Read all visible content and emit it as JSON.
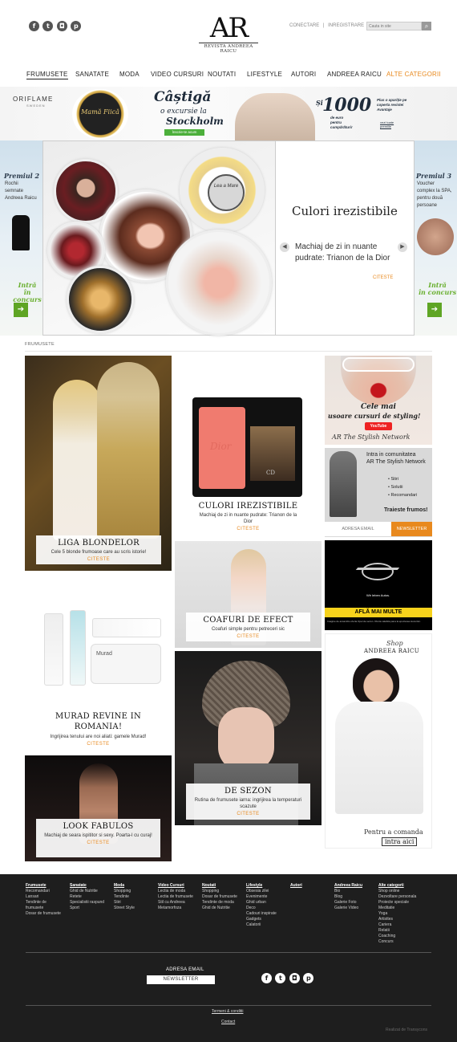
{
  "header": {
    "logo_text": "AR",
    "logo_sub": "REVISTA ANDREEA RAICU",
    "login": "CONECTARE",
    "sep": "|",
    "register": "INREGISTRARE",
    "search_placeholder": "Cauta in site"
  },
  "nav": [
    "FRUMUSETE",
    "SANATATE",
    "MODA",
    "VIDEO CURSURI",
    "NOUTATI",
    "LIFESTYLE",
    "AUTORI",
    "ANDREEA RAICU",
    "ALTE CATEGORII"
  ],
  "banner": {
    "oriflame": "ORIFLAME",
    "brand": "SWEDEN",
    "castiga": "Câștigă",
    "excursie": "o excursie la",
    "oras": "Stockholm",
    "mama": "Mamă Fiică",
    "cta": "Înscrie-te acum",
    "suma": "1000",
    "si": "Și",
    "euro": "de euro pentru cumpărături!",
    "plus": "Plus o apariție pe coperta revistei Avantaje",
    "vezi": "vezi toate premiile"
  },
  "promo_left": {
    "title": "Premiul 2",
    "line1": "Rochii",
    "line2": "semnate",
    "line3": "Andreea Raicu",
    "cta1": "Intră",
    "cta2": "în concurs"
  },
  "promo_right": {
    "title": "Premiul 3",
    "line1": "Voucher",
    "line2": "complex la SPA,",
    "line3": "pentru două",
    "line4": "persoane",
    "cta1": "Intră",
    "cta2": "în concurs"
  },
  "slider": {
    "headline": "Culori irezistibile",
    "subtitle": "Machiaj de zi in nuante pudrate: Trianon de la Dior",
    "read": "CITESTE",
    "jar_label": "Lea a Mare"
  },
  "section_label": "FRUMUSETE",
  "cards": {
    "liga": {
      "title": "LIGA BLONDELOR",
      "sub": "Cele 5 blonde frumoase care au scris istorie!",
      "read": "CITESTE"
    },
    "culori": {
      "title": "CULORI IREZISTIBILE",
      "sub": "Machiaj de zi in nuante pudrate: Trianon de la Dior",
      "read": "CITESTE",
      "brand": "Dior",
      "brand2": "CD"
    },
    "coafuri": {
      "title": "COAFURI DE EFECT",
      "sub": "Coafuri simple pentru petreceri sic",
      "read": "CITESTE"
    },
    "murad": {
      "title": "MURAD REVINE IN ROMANIA!",
      "sub": "Ingrijirea tenului are noi aliati: gamele Murad!",
      "read": "CITESTE",
      "brand": "Murad"
    },
    "sezon": {
      "title": "DE SEZON",
      "sub": "Rutina de frumusete iarna: ingrijirea la temperaturi scazute",
      "read": "CITESTE"
    },
    "look": {
      "title": "LOOK FABULOS",
      "sub": "Machiaj de seara ispititor si sexy. Poarta-l cu curaj!",
      "read": "CITESTE"
    }
  },
  "sidebar": {
    "styling1": "Cele mai",
    "styling2": "usoare cursuri de styling!",
    "youtube": "YouTube",
    "network": "AR The Stylish Network",
    "comm1": "Intra in comunitatea",
    "comm2": "AR The Stylish Network",
    "bullets": [
      "Stiri",
      "Solutii",
      "Recomandari"
    ],
    "slogan": "Traieste frumos!",
    "email_ph": "ADRESA EMAIL",
    "newsletter": "NEWSLETTER",
    "opel_tag": "Wir leben Autos.",
    "opel_cta": "AFLĂ MAI MULTE",
    "opel_fine": "Imagine de ansamblu oferta Opel de sezon. Oferta valabila pana la epuizarea stocurilor.",
    "shop1": "Shop",
    "shop2": "ANDREEA RAICU",
    "order1": "Pentru a comanda",
    "order2": "intra aici"
  },
  "footer": {
    "cols": [
      {
        "h": "Frumusete",
        "items": [
          "Recomandari",
          "Lansari",
          "Tendinte de frumusete",
          "Dosar de frumusete"
        ]
      },
      {
        "h": "Sanatate",
        "items": [
          "Ghid de Nutritie",
          "Retete",
          "Specialistii raspund",
          "Sport"
        ]
      },
      {
        "h": "Moda",
        "items": [
          "Shopping",
          "Tendinte",
          "Stiri",
          "Street Style"
        ]
      },
      {
        "h": "Video Cursuri",
        "items": [
          "Lectia de moda",
          "Lectia de frumusete",
          "Stil cu Andreea",
          "Metamorfoza"
        ]
      },
      {
        "h": "Noutati",
        "items": [
          "Shopping",
          "Dosar de frumusete",
          "Tendinte de moda",
          "Ghid de Nutritie"
        ]
      },
      {
        "h": "Lifestyle",
        "items": [
          "Obsesia zilei",
          "Evenimente",
          "Ghid urban",
          "Deco",
          "Cadouri inspirate",
          "Gadgets",
          "Calatorii"
        ]
      },
      {
        "h": "Autori",
        "items": []
      },
      {
        "h": "Andreea Raicu",
        "items": [
          "Bio",
          "Blog",
          "Galerie Foto",
          "Galerie Video"
        ]
      },
      {
        "h": "Alte categorii",
        "items": [
          "Shop online",
          "Dezvoltare personala",
          "Proiecte speciale",
          "Meditatie",
          "Yoga",
          "Artisttes",
          "Cariera",
          "Relatii",
          "Coaching",
          "Concurs"
        ]
      }
    ],
    "email_label": "ADRESA EMAIL",
    "newsletter": "NEWSLETTER",
    "terms": "Termeni & conditii",
    "contact": "Contact",
    "realized": "Realizat de Transycons"
  },
  "colors": {
    "accent": "#e8891e",
    "footer_bg": "#1e1e1e"
  }
}
